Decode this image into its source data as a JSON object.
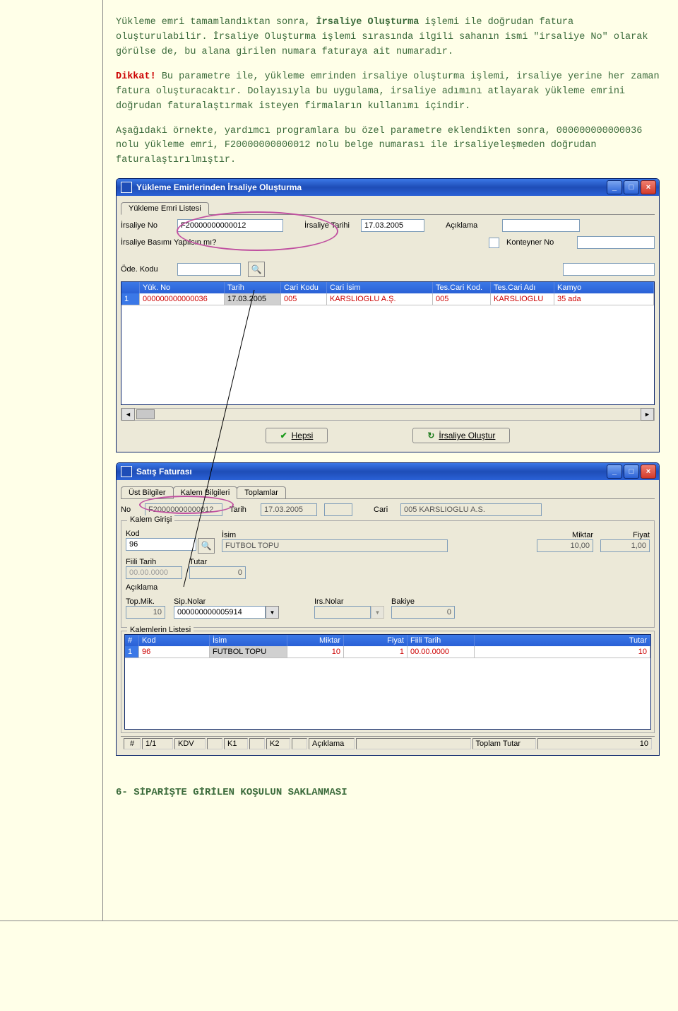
{
  "paragraphs": {
    "p1a": "Yükleme emri tamamlandıktan sonra, ",
    "p1b": "İrsaliye Oluşturma",
    "p1c": " işlemi ile doğrudan fatura oluşturulabilir. İrsaliye Oluşturma işlemi sırasında ilgili sahanın ismi \"irsaliye No\" olarak görülse de, bu alana girilen numara faturaya ait numaradır.",
    "p2a": "Dikkat!",
    "p2b": " Bu parametre ile, yükleme emrinden irsaliye oluşturma işlemi, irsaliye yerine her zaman fatura oluşturacaktır. Dolayısıyla bu uygulama, irsaliye adımını atlayarak yükleme emrini doğrudan faturalaştırmak isteyen firmaların kullanımı içindir.",
    "p3": "Aşağıdaki örnekte, yardımcı programlara bu özel parametre eklendikten sonra, 000000000000036 nolu yükleme emri, F20000000000012 nolu belge numarası ile irsaliyeleşmeden doğrudan faturalaştırılmıştır."
  },
  "section_title": "6- SİPARİŞTE GİRİLEN KOŞULUN SAKLANMASI",
  "window1": {
    "title": "Yükleme Emirlerinden İrsaliye Oluşturma",
    "tab": "Yükleme Emri Listesi",
    "labels": {
      "irsaliye_no": "İrsaliye No",
      "irsaliye_tarihi": "İrsaliye Tarihi",
      "aciklama": "Açıklama",
      "basim": "İrsaliye Basımı Yapılsın mı?",
      "konteyner": "Konteyner No",
      "ode_kodu": "Öde. Kodu"
    },
    "values": {
      "irsaliye_no": "F20000000000012",
      "irsaliye_tarihi": "17.03.2005"
    },
    "grid": {
      "headers": [
        "",
        "Yük. No",
        "Tarih",
        "Cari Kodu",
        "Cari İsim",
        "Tes.Cari Kod.",
        "Tes.Cari Adı",
        "Kamyo"
      ],
      "row": [
        "1",
        "000000000000036",
        "17.03.2005",
        "005",
        "KARSLIOGLU A.Ş.",
        "005",
        "KARSLIOGLU",
        "35 ada"
      ]
    },
    "buttons": {
      "hepsi": "Hepsi",
      "olustur": "İrsaliye Oluştur"
    }
  },
  "window2": {
    "title": "Satış Faturası",
    "tabs": [
      "Üst Bilgiler",
      "Kalem Bilgileri",
      "Toplamlar"
    ],
    "labels": {
      "no": "No",
      "tarih": "Tarih",
      "cari": "Cari",
      "kalem_girisi": "Kalem Girişi",
      "kod": "Kod",
      "isim": "İsim",
      "miktar": "Miktar",
      "fiyat": "Fiyat",
      "fiili_tarih": "Fiili Tarih",
      "tutar": "Tutar",
      "aciklama": "Açıklama",
      "top_mik": "Top.Mik.",
      "sip_nolar": "Sip.Nolar",
      "irs_nolar": "Irs.Nolar",
      "bakiye": "Bakiye",
      "kalemlerin_listesi": "Kalemlerin Listesi"
    },
    "values": {
      "no": "F20000000000012",
      "tarih": "17.03.2005",
      "cari": "005 KARSLIOGLU A.S.",
      "kod": "96",
      "isim": "FUTBOL TOPU",
      "miktar": "10,00",
      "fiyat": "1,00",
      "fiili_tarih": "00.00.0000",
      "tutar": "0",
      "top_mik": "10",
      "sip_nolar": "000000000005914",
      "bakiye": "0"
    },
    "grid": {
      "headers": [
        "#",
        "Kod",
        "İsim",
        "Miktar",
        "Fiyat",
        "Fiili Tarih",
        "Tutar"
      ],
      "row": [
        "1",
        "96",
        "FUTBOL TOPU",
        "10",
        "1",
        "00.00.0000",
        "10"
      ]
    },
    "status": {
      "pager": "1/1",
      "kdv": "KDV",
      "k1": "K1",
      "k2": "K2",
      "aciklama": "Açıklama",
      "toplam": "Toplam Tutar",
      "toplam_val": "10"
    }
  }
}
